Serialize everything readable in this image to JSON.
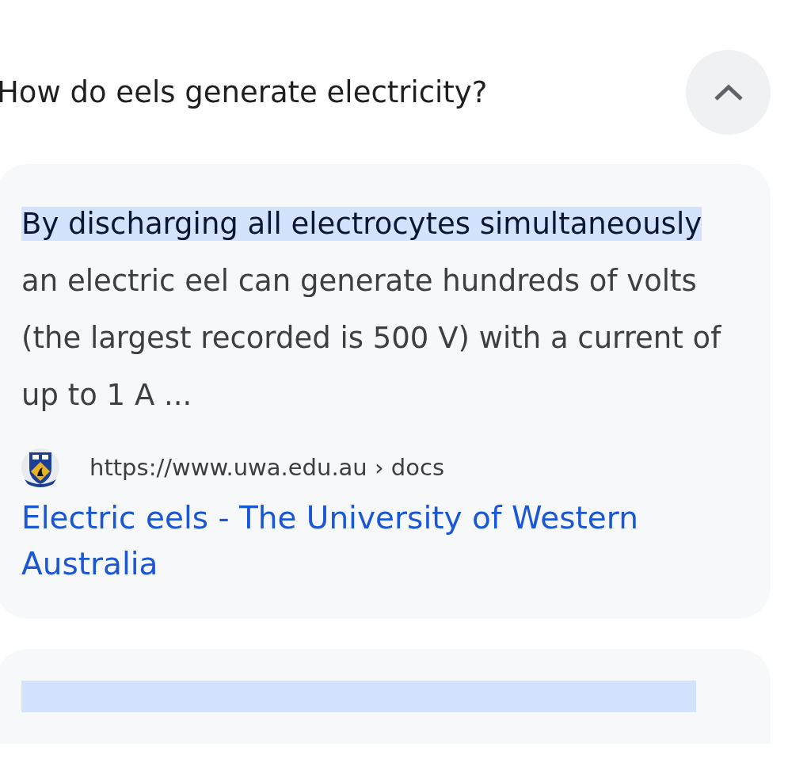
{
  "question": {
    "text": "How do eels generate electricity?",
    "expanded": true
  },
  "answer": {
    "highlight": "By discharging all electrocytes simultaneously",
    "text": " an electric eel can generate hundreds of volts (the largest recorded is 500 V) with a current of up to 1 A ..."
  },
  "source": {
    "url": "https://www.uwa.edu.au › docs",
    "title": "Electric eels - The University of Western Australia"
  }
}
